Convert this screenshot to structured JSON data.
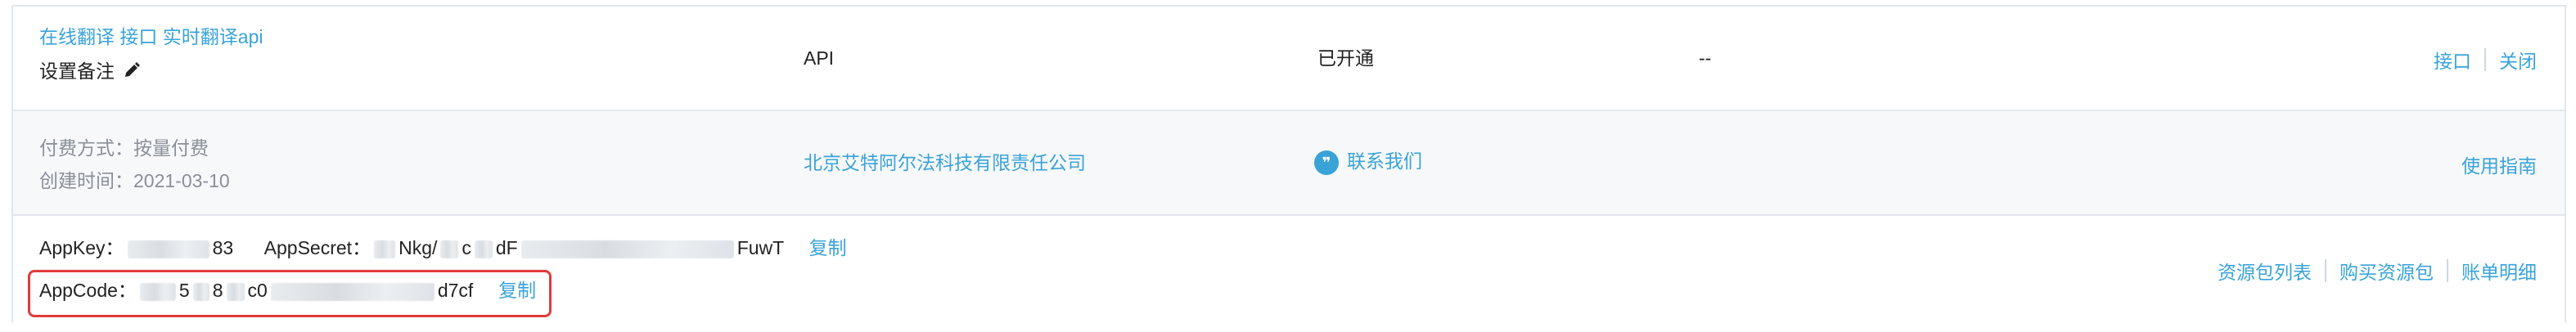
{
  "service": {
    "name_links": "在线翻译 接口 实时翻译api",
    "remark_label": "设置备注",
    "type": "API",
    "status": "已开通",
    "extra": "--",
    "ops": [
      "接口",
      "关闭"
    ]
  },
  "billing": {
    "pay_method": "付费方式：按量付费",
    "created": "创建时间：2021-03-10",
    "company": "北京艾特阿尔法科技有限责任公司",
    "contact": "联系我们",
    "guide": "使用指南"
  },
  "keys": {
    "appkey_label": "AppKey：",
    "appkey_tail": "83",
    "appsecret_label": "AppSecret：",
    "appsecret_mid1": "Nkg/",
    "appsecret_mid2": "c",
    "appsecret_mid3": "dF",
    "appsecret_tail": "FuwT",
    "copy": "复制",
    "appcode_label": "AppCode：",
    "appcode_mid": "5",
    "appcode_mid2": "8",
    "appcode_mid3": "c0",
    "appcode_tail": "d7cf",
    "copy2": "复制",
    "ops": [
      "资源包列表",
      "购买资源包",
      "账单明细"
    ]
  },
  "colors": {
    "link": "#39a3d8",
    "highlight": "#e23b3b"
  }
}
